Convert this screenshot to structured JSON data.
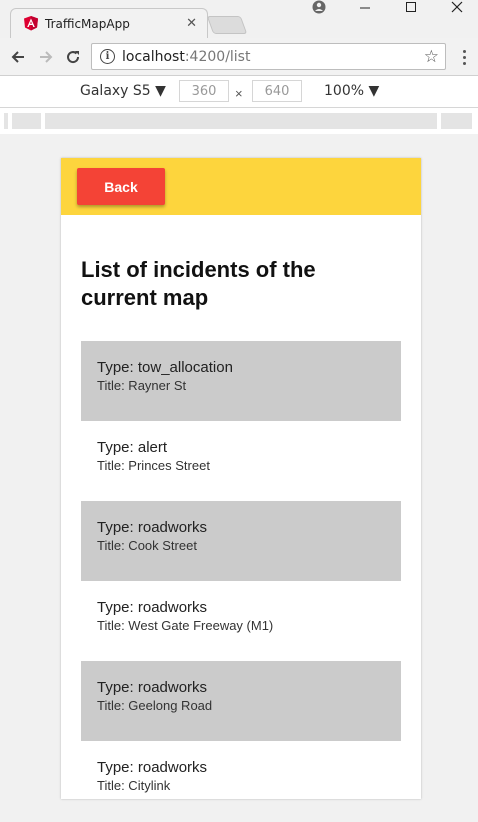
{
  "browser": {
    "tab_title": "TrafficMapApp",
    "tab_close": "✕",
    "url_host": "localhost",
    "url_path": ":4200/list"
  },
  "device_toolbar": {
    "device": "Galaxy S5 ▼",
    "width": "360",
    "height": "640",
    "separator": "×",
    "zoom": "100% ▼"
  },
  "app": {
    "header_color": "#fdd53d",
    "back_label": "Back",
    "back_color": "#f44336",
    "title": "List of incidents of the current map",
    "incidents": [
      {
        "type": "Type: tow_allocation",
        "title": "Title: Rayner St"
      },
      {
        "type": "Type: alert",
        "title": "Title: Princes Street"
      },
      {
        "type": "Type: roadworks",
        "title": "Title: Cook Street"
      },
      {
        "type": "Type: roadworks",
        "title": "Title: West Gate Freeway (M1)"
      },
      {
        "type": "Type: roadworks",
        "title": "Title: Geelong Road"
      },
      {
        "type": "Type: roadworks",
        "title": "Title: Citylink"
      }
    ]
  }
}
